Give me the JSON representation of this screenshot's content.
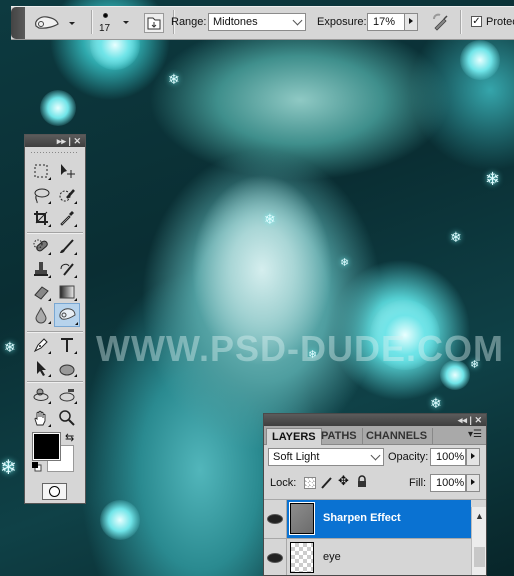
{
  "options_bar": {
    "tool_preset_icon": "sponge-tool-icon",
    "brush_size": "17",
    "brush_panel_icon": "brush-panel-toggle-icon",
    "range_label": "Range:",
    "range_value": "Midtones",
    "exposure_label": "Exposure:",
    "exposure_value": "17%",
    "airbrush_icon": "airbrush-icon",
    "protect_checked": true,
    "protect_label": "Protect Tones",
    "protect_label_visible": "Protec"
  },
  "toolbox": {
    "tools": [
      {
        "name": "rectangular-marquee-tool",
        "icon": "marquee-icon"
      },
      {
        "name": "move-tool",
        "icon": "move-icon"
      },
      {
        "name": "lasso-tool",
        "icon": "lasso-icon"
      },
      {
        "name": "quick-selection-tool",
        "icon": "quick-selection-icon"
      },
      {
        "name": "crop-tool",
        "icon": "crop-icon"
      },
      {
        "name": "eyedropper-tool",
        "icon": "eyedropper-icon"
      },
      {
        "name": "spot-healing-brush-tool",
        "icon": "healing-icon"
      },
      {
        "name": "brush-tool",
        "icon": "brush-icon"
      },
      {
        "name": "clone-stamp-tool",
        "icon": "stamp-icon"
      },
      {
        "name": "history-brush-tool",
        "icon": "history-brush-icon"
      },
      {
        "name": "eraser-tool",
        "icon": "eraser-icon"
      },
      {
        "name": "gradient-tool",
        "icon": "gradient-icon"
      },
      {
        "name": "blur-tool",
        "icon": "blur-drop-icon"
      },
      {
        "name": "sponge-tool",
        "icon": "sponge-icon",
        "active": true
      },
      {
        "name": "pen-tool",
        "icon": "pen-icon"
      },
      {
        "name": "type-tool",
        "icon": "type-icon"
      },
      {
        "name": "path-selection-tool",
        "icon": "arrow-icon"
      },
      {
        "name": "ellipse-tool",
        "icon": "ellipse-icon"
      },
      {
        "name": "3d-rotate-tool",
        "icon": "3d-rotate-icon"
      },
      {
        "name": "3d-orbit-tool",
        "icon": "3d-orbit-icon"
      },
      {
        "name": "hand-tool",
        "icon": "hand-icon"
      },
      {
        "name": "zoom-tool",
        "icon": "zoom-icon"
      }
    ],
    "foreground_color": "#000000",
    "background_color": "#ffffff"
  },
  "canvas": {
    "watermark": "WWW.PSD-DUDE.COM"
  },
  "layers_panel": {
    "tabs": [
      {
        "label": "LAYERS",
        "active": true
      },
      {
        "label": "PATHS",
        "active": false
      },
      {
        "label": "CHANNELS",
        "active": false
      }
    ],
    "blend_mode": "Soft Light",
    "opacity_label": "Opacity:",
    "opacity_value": "100%",
    "lock_label": "Lock:",
    "fill_label": "Fill:",
    "fill_value": "100%",
    "layers": [
      {
        "name": "Sharpen Effect",
        "visible": true,
        "selected": true
      },
      {
        "name": "eye",
        "visible": true,
        "selected": false
      }
    ],
    "selected_color": "#0a72d2"
  }
}
